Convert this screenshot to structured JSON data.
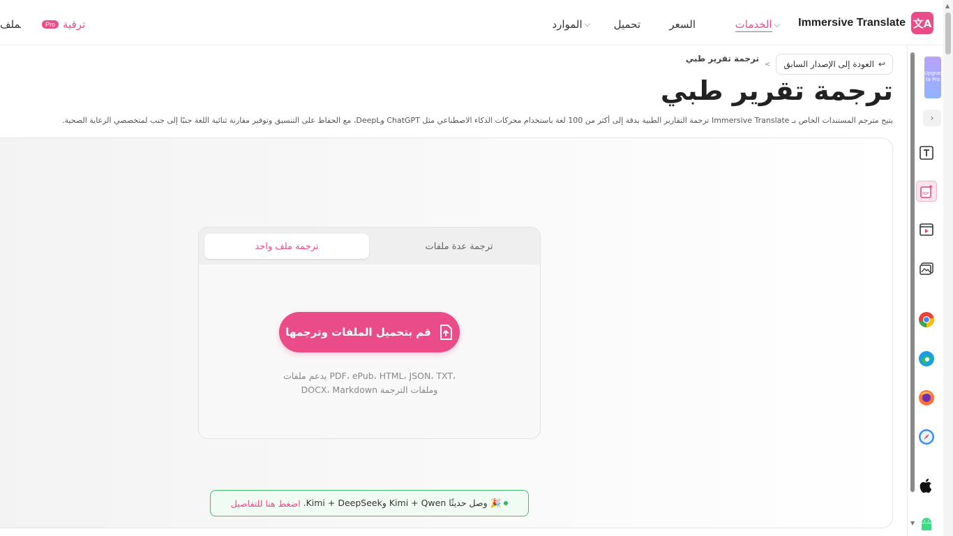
{
  "nav": {
    "brand": "Immersive Translate",
    "services": "الخدمات",
    "pricing": "السعر",
    "download": "تحميل",
    "resources": "الموارد",
    "upgrade": "ترقية",
    "pro_badge": "Pro",
    "cut_link": "الملف"
  },
  "breadcrumb": {
    "back_label": "العودة إلى الإصدار السابق",
    "separator": ">",
    "current": "ترجمة تقرير طبي"
  },
  "page": {
    "title": "ترجمة تقرير طبي",
    "description": "يتيح مترجم المستندات الخاص بـ Immersive Translate ترجمة التقارير الطبية بدقة إلى أكثر من 100 لغة باستخدام محركات الذكاء الاصطناعي مثل ChatGPT وDeepL، مع الحفاظ على التنسيق وتوفير مقارنة ثنائية اللغة جنبًا إلى جنب لمتخصصي الرعاية الصحية."
  },
  "upload": {
    "tab_single": "ترجمة ملف واحد",
    "tab_multi": "ترجمة عدة ملفات",
    "button_label": "قم بتحميل الملفات وترجمها",
    "support_line1": "يدعم ملفات PDF، ePub، HTML، JSON، TXT،",
    "support_line2": "DOCX، Markdown وملفات الترجمة"
  },
  "news": {
    "text": "🎉 وصل حديثًا Kimi + Qwen وKimi + DeepSeek.",
    "link": "اضغط هنا للتفاصيل"
  },
  "sidebar": {
    "promo": "Upgrade to Pro",
    "icons": [
      "text-translate-icon",
      "pdf-translate-icon",
      "video-icon",
      "image-icon",
      "chrome-icon",
      "edge-icon",
      "firefox-icon",
      "safari-icon",
      "apple-icon",
      "android-icon"
    ]
  },
  "colors": {
    "accent": "#ea4c89",
    "news_border": "#3cc06a"
  }
}
